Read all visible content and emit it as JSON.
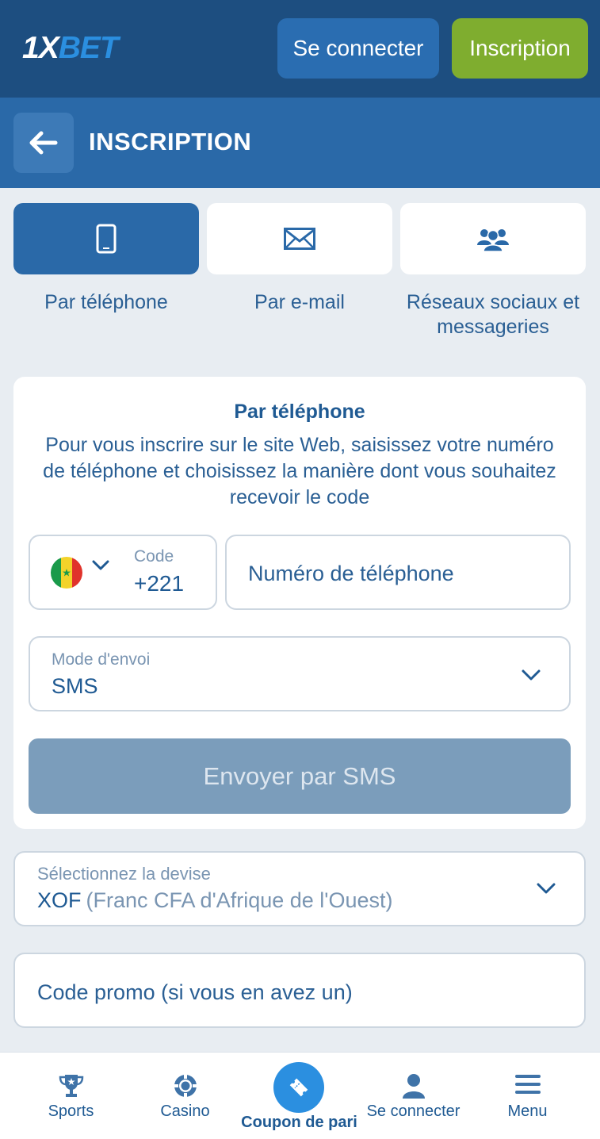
{
  "header": {
    "logo_part1": "1X",
    "logo_part2": "BET",
    "login_label": "Se connecter",
    "register_label": "Inscription"
  },
  "page": {
    "title": "INSCRIPTION"
  },
  "tabs": [
    {
      "label": "Par téléphone",
      "icon": "phone-icon",
      "active": true
    },
    {
      "label": "Par e-mail",
      "icon": "envelope-icon",
      "active": false
    },
    {
      "label_line1": "Réseaux sociaux et",
      "label_line2": "messageries",
      "icon": "people-icon",
      "active": false
    }
  ],
  "form": {
    "title": "Par téléphone",
    "description": "Pour vous inscrire sur le site Web, saisissez votre numéro de téléphone et choisissez la manière dont vous souhaitez recevoir le code",
    "code_label": "Code",
    "code_value": "+221",
    "phone_placeholder": "Numéro de téléphone",
    "mode_label": "Mode d'envoi",
    "mode_value": "SMS",
    "send_label": "Envoyer par SMS"
  },
  "currency": {
    "label": "Sélectionnez la devise",
    "code": "XOF",
    "name": "(Franc CFA d'Afrique de l'Ouest)"
  },
  "promo": {
    "placeholder": "Code promo (si vous en avez un)"
  },
  "bottom_nav": [
    {
      "label": "Sports",
      "icon": "trophy-icon"
    },
    {
      "label": "Casino",
      "icon": "casino-chip-icon"
    },
    {
      "label": "Coupon de pari",
      "icon": "ticket-icon"
    },
    {
      "label": "Se connecter",
      "icon": "user-icon"
    },
    {
      "label": "Menu",
      "icon": "menu-icon"
    }
  ],
  "colors": {
    "topbar": "#1d4e80",
    "header": "#2a69a8",
    "login_button": "#2a6db1",
    "register_button": "#7fad2f",
    "send_button_disabled": "#7b9dbb",
    "fab": "#2b8fe0",
    "text": "#1f5a93"
  }
}
